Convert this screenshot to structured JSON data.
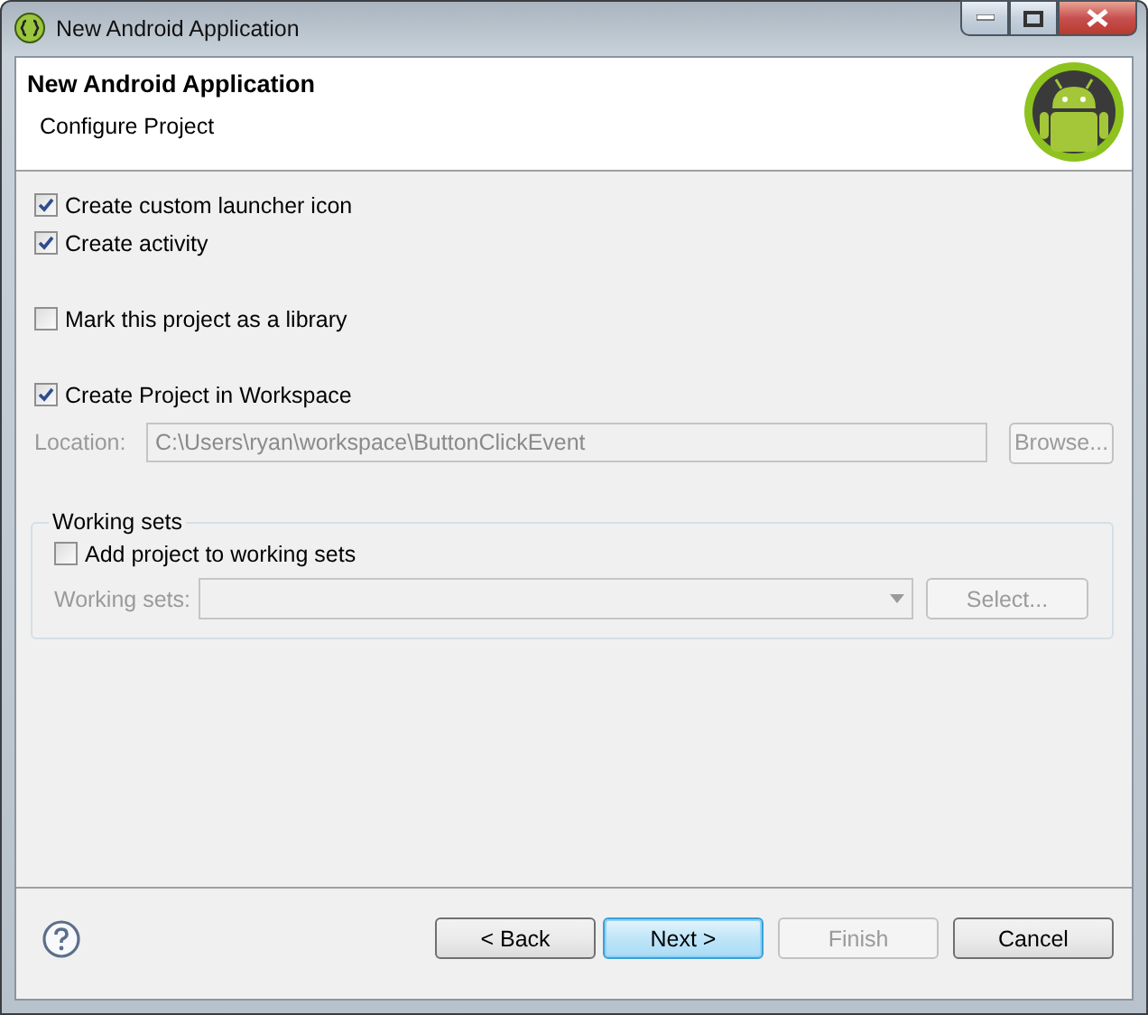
{
  "window": {
    "title": "New Android Application"
  },
  "window_controls": [
    {
      "kind": "minimize"
    },
    {
      "kind": "maximize"
    },
    {
      "kind": "close"
    }
  ],
  "header": {
    "title": "New Android Application",
    "subtitle": "Configure Project"
  },
  "launcher_options": [
    {
      "label": "Create custom launcher icon",
      "checked": true
    },
    {
      "label": "Create activity",
      "checked": true
    }
  ],
  "library_option": {
    "label": "Mark this project as a library",
    "checked": false
  },
  "workspace_option": {
    "label": "Create Project in Workspace",
    "checked": true
  },
  "location": {
    "label": "Location:",
    "value": "C:\\Users\\ryan\\workspace\\ButtonClickEvent",
    "disabled": true,
    "browse_label": "Browse..."
  },
  "working_sets": {
    "title": "Working sets",
    "add_option": {
      "label": "Add project to working sets",
      "checked": false
    },
    "field_label": "Working sets:",
    "disabled": true,
    "select_label": "Select..."
  },
  "buttons": [
    {
      "label": "< Back",
      "disabled": false,
      "default": false
    },
    {
      "label": "Next >",
      "disabled": false,
      "default": true
    },
    {
      "label": "Finish",
      "disabled": true,
      "default": false
    },
    {
      "label": "Cancel",
      "disabled": false,
      "default": false
    }
  ]
}
